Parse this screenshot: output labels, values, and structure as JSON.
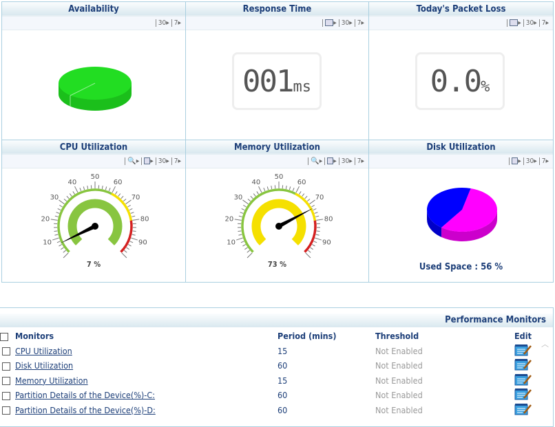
{
  "panels": {
    "availability": {
      "title": "Availability",
      "tools": [
        "30",
        "7"
      ],
      "pie_color": "#22dd22"
    },
    "response": {
      "title": "Response Time",
      "tools": [
        "30",
        "7"
      ],
      "value": "001",
      "unit": "ms"
    },
    "packet": {
      "title": "Today's Packet Loss",
      "tools": [
        "30",
        "7"
      ],
      "value": "0.0",
      "unit": "%"
    },
    "cpu": {
      "title": "CPU Utilization",
      "tools": [
        "30",
        "7"
      ],
      "value": 7,
      "label": "7 %"
    },
    "memory": {
      "title": "Memory Utilization",
      "tools": [
        "30",
        "7"
      ],
      "value": 73,
      "label": "73 %"
    },
    "disk": {
      "title": "Disk Utilization",
      "tools": [
        "30",
        "7"
      ],
      "used_percent": 56,
      "label": "Used Space : 56 %",
      "colors": {
        "used": "#ff00ff",
        "free": "#0000ff"
      }
    }
  },
  "gauge": {
    "ticks": [
      "0",
      "10",
      "20",
      "30",
      "40",
      "50",
      "60",
      "70",
      "80",
      "90",
      "100"
    ],
    "bands": [
      {
        "from": 0,
        "to": 60,
        "color": "#88c540"
      },
      {
        "from": 60,
        "to": 80,
        "color": "#f5e000"
      },
      {
        "from": 80,
        "to": 100,
        "color": "#d42020"
      }
    ]
  },
  "monitors": {
    "title": "Performance Monitors",
    "headers": {
      "name": "Monitors",
      "period": "Period (mins)",
      "threshold": "Threshold",
      "edit": "Edit"
    },
    "rows": [
      {
        "name": "CPU Utilization",
        "period": "15",
        "threshold": "Not Enabled"
      },
      {
        "name": "Disk Utilization",
        "period": "60",
        "threshold": "Not Enabled"
      },
      {
        "name": "Memory Utilization",
        "period": "15",
        "threshold": "Not Enabled"
      },
      {
        "name": "Partition Details of the Device(%)-C:",
        "period": "60",
        "threshold": "Not Enabled"
      },
      {
        "name": "Partition Details of the Device(%)-D:",
        "period": "60",
        "threshold": "Not Enabled"
      }
    ]
  }
}
